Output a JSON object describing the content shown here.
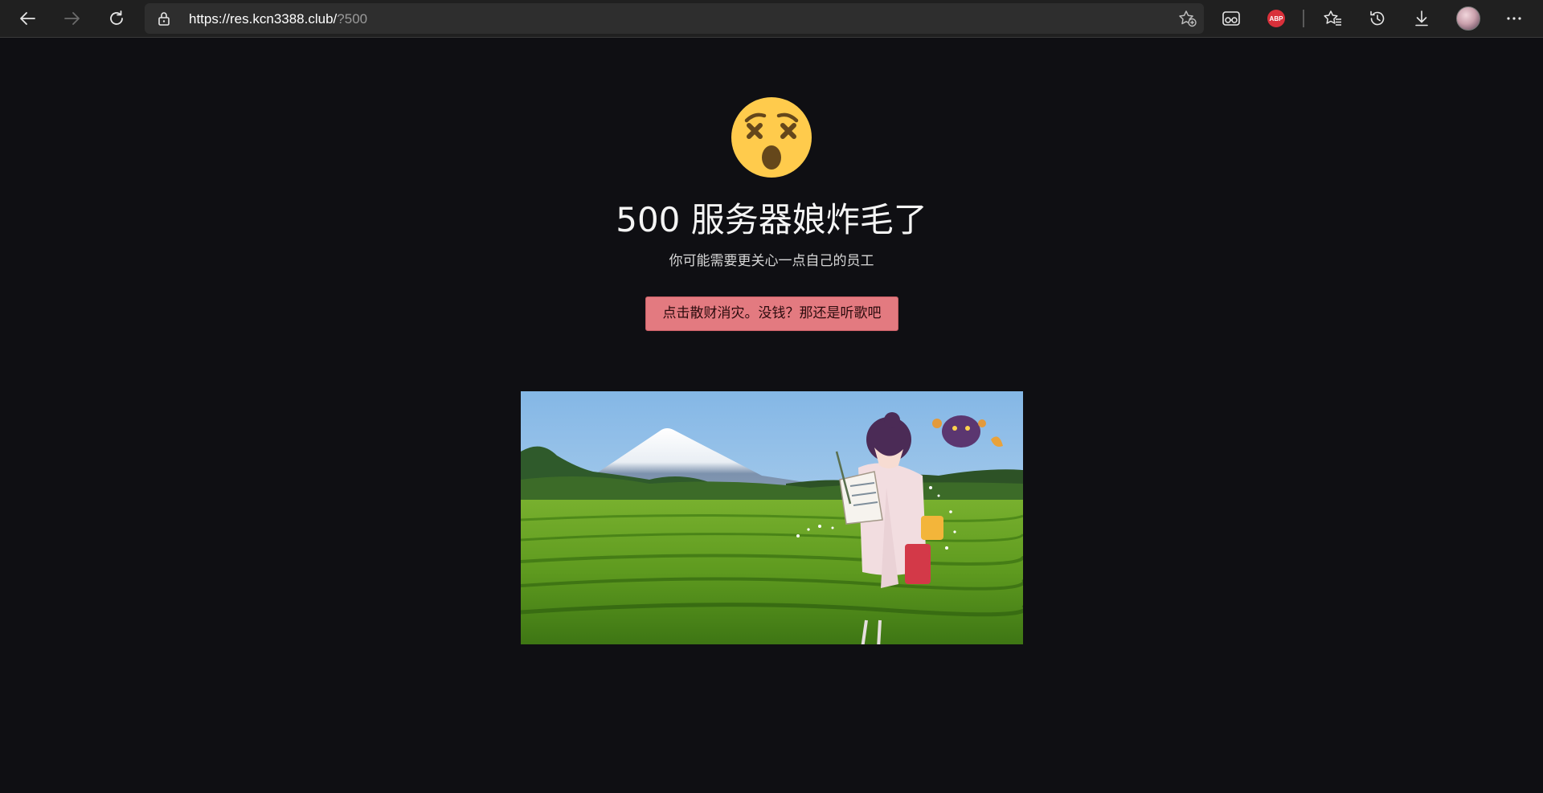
{
  "browser": {
    "url_host": "https://res.kcn3388.club/",
    "url_path": "?500",
    "abp_label": "ABP",
    "icons": [
      "back-icon",
      "forward-icon",
      "refresh-icon",
      "lock-icon",
      "add-favorite-icon",
      "immersive-reader-icon",
      "adblock-icon",
      "favorites-icon",
      "history-icon",
      "download-icon",
      "profile-avatar",
      "more-icon"
    ]
  },
  "error": {
    "title": "500 服务器娘炸毛了",
    "subtitle": "你可能需要更关心一点自己的员工",
    "button_label": "点击散财消灾。没钱？那还是听歌吧",
    "emoji": "dizzy-face-icon"
  },
  "colors": {
    "page_background": "#0f0f13",
    "toolbar_background": "#202020",
    "button_background": "#e37a80",
    "emoji_yellow": "#ffcb4c"
  }
}
